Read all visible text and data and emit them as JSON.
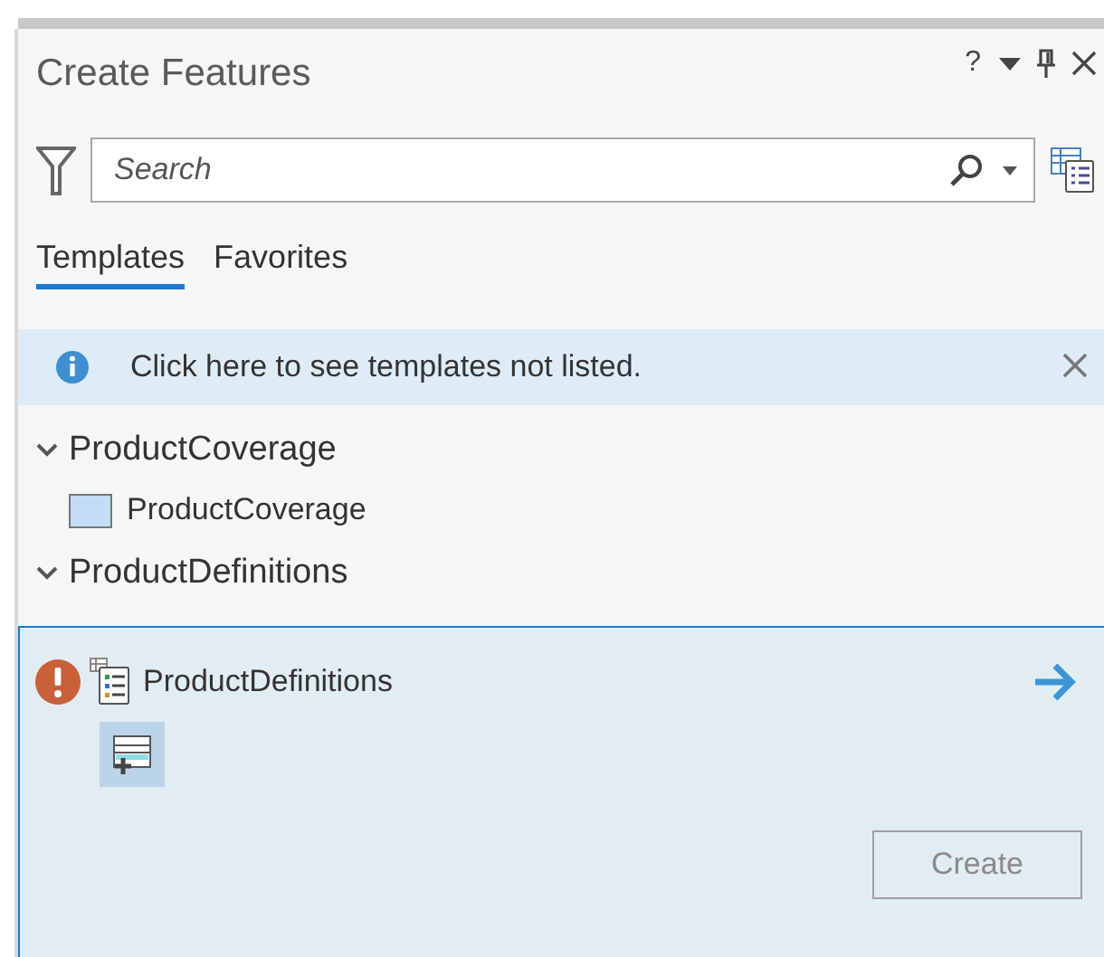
{
  "pane": {
    "title": "Create Features",
    "help": "?"
  },
  "search": {
    "placeholder": "Search"
  },
  "tabs": [
    {
      "label": "Templates",
      "selected": true
    },
    {
      "label": "Favorites",
      "selected": false
    }
  ],
  "info": {
    "message": "Click here to see templates not listed."
  },
  "groups": [
    {
      "name": "ProductCoverage",
      "expanded": true,
      "items": [
        {
          "name": "ProductCoverage",
          "kind": "polygon"
        }
      ]
    },
    {
      "name": "ProductDefinitions",
      "expanded": true
    }
  ],
  "selected_template": {
    "name": "ProductDefinitions",
    "warning": true,
    "tool_selected": true,
    "create": {
      "label": "Create",
      "disabled": true
    }
  }
}
